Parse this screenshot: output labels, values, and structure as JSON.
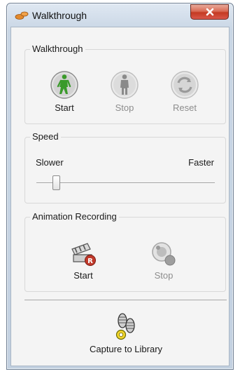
{
  "window": {
    "title": "Walkthrough",
    "close_icon": "close-icon"
  },
  "walkthrough": {
    "group_label": "Walkthrough",
    "start": {
      "label": "Start",
      "icon": "walking-person-green-icon",
      "enabled": true
    },
    "stop": {
      "label": "Stop",
      "icon": "person-standing-gray-icon",
      "enabled": false
    },
    "reset": {
      "label": "Reset",
      "icon": "reset-arrows-gray-icon",
      "enabled": false
    }
  },
  "speed": {
    "group_label": "Speed",
    "slower_label": "Slower",
    "faster_label": "Faster",
    "slider_value": 0.11
  },
  "animation_recording": {
    "group_label": "Animation Recording",
    "start": {
      "label": "Start",
      "icon": "clapper-record-icon",
      "enabled": true
    },
    "stop": {
      "label": "Stop",
      "icon": "reel-stop-gray-icon",
      "enabled": false
    }
  },
  "capture": {
    "label": "Capture to Library",
    "icon": "footprints-capture-icon"
  },
  "colors": {
    "accent_green": "#3a9a2a",
    "record_red": "#c0392b",
    "disabled_text": "#8d8d8d"
  }
}
